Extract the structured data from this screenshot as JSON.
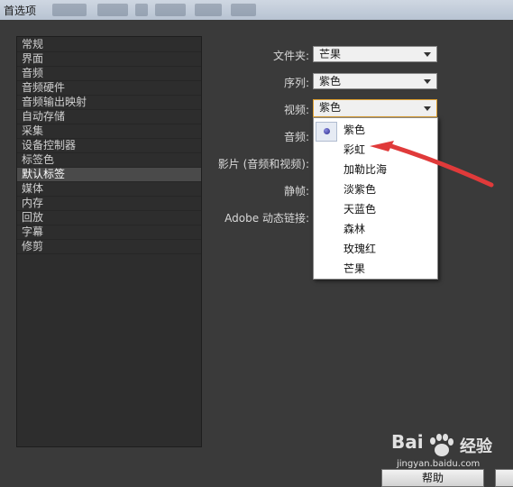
{
  "window": {
    "title": "首选项"
  },
  "sidebar": {
    "items": [
      {
        "label": "常规"
      },
      {
        "label": "界面"
      },
      {
        "label": "音频"
      },
      {
        "label": "音频硬件"
      },
      {
        "label": "音频输出映射"
      },
      {
        "label": "自动存储"
      },
      {
        "label": "采集"
      },
      {
        "label": "设备控制器"
      },
      {
        "label": "标签色"
      },
      {
        "label": "默认标签"
      },
      {
        "label": "媒体"
      },
      {
        "label": "内存"
      },
      {
        "label": "回放"
      },
      {
        "label": "字幕"
      },
      {
        "label": "修剪"
      }
    ],
    "selected": "默认标签"
  },
  "form": {
    "folder_label": "文件夹:",
    "folder_value": "芒果",
    "sequence_label": "序列:",
    "sequence_value": "紫色",
    "video_label": "视频:",
    "video_value": "紫色",
    "audio_label": "音频:",
    "movie_label": "影片 (音频和视频):",
    "still_label": "静帧:",
    "dynamic_link_label": "Adobe 动态链接:"
  },
  "dropdown": {
    "options": [
      "紫色",
      "彩虹",
      "加勒比海",
      "淡紫色",
      "天蓝色",
      "森林",
      "玫瑰红",
      "芒果"
    ],
    "selected": "紫色"
  },
  "buttons": {
    "help_label": "帮助"
  },
  "watermark": {
    "logo": "Bai",
    "brand": "经验",
    "url": "jingyan.baidu.com"
  },
  "colors": {
    "background": "#3a3a3a",
    "sidebar_bg": "#2d2d2d",
    "focus_border": "#e0a030",
    "annotation_arrow": "#e03a3a"
  }
}
